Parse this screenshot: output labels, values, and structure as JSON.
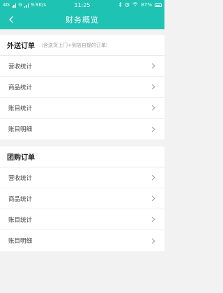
{
  "status_bar": {
    "network": "4G",
    "network2": "G",
    "speed": "9.9K/s",
    "time": "11:25",
    "battery": "87%",
    "icons": [
      "signal-icon",
      "bluetooth-icon",
      "alarm-icon",
      "wifi-icon",
      "battery-icon"
    ]
  },
  "nav": {
    "title": "财务概览",
    "back_icon": "chevron-left-icon",
    "color": "#1fc3b3"
  },
  "sections": [
    {
      "title": "外送订单",
      "note": "（含送货上门+到店自提的订单）",
      "items": [
        {
          "label": "营收统计"
        },
        {
          "label": "商品统计"
        },
        {
          "label": "账目统计"
        },
        {
          "label": "账目明细"
        }
      ]
    },
    {
      "title": "团购订单",
      "note": "",
      "items": [
        {
          "label": "营收统计"
        },
        {
          "label": "商品统计"
        },
        {
          "label": "账目统计"
        },
        {
          "label": "账目明细"
        }
      ]
    }
  ]
}
